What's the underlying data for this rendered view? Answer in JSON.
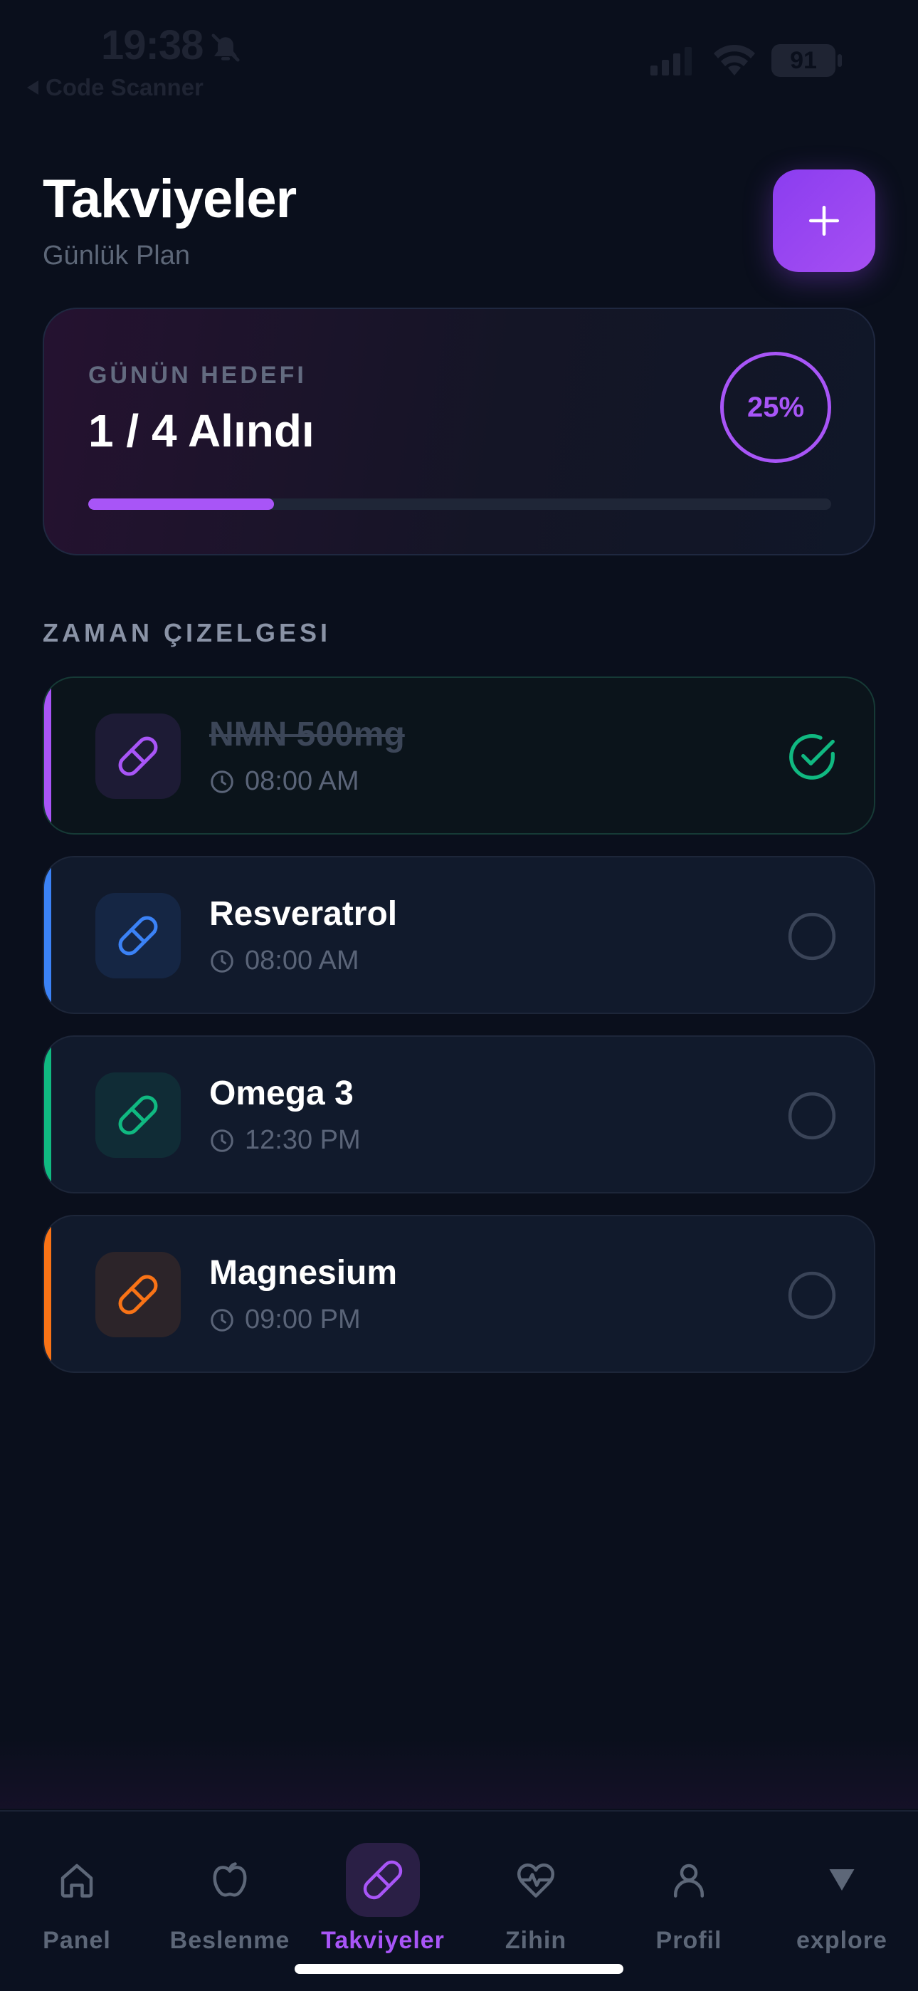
{
  "status_bar": {
    "time": "19:38",
    "back_label": "Code Scanner",
    "battery": "91"
  },
  "header": {
    "title": "Takviyeler",
    "subtitle": "Günlük Plan"
  },
  "goal": {
    "label": "GÜNÜN HEDEFI",
    "value": "1 / 4 Alındı",
    "percent_label": "25%",
    "progress": 0.25
  },
  "schedule": {
    "title": "ZAMAN ÇIZELGESI",
    "items": [
      {
        "name": "NMN 500mg",
        "time": "08:00 AM",
        "done": true,
        "color": "#a855f7"
      },
      {
        "name": "Resveratrol",
        "time": "08:00 AM",
        "done": false,
        "color": "#3b82f6"
      },
      {
        "name": "Omega 3",
        "time": "12:30 PM",
        "done": false,
        "color": "#10b981"
      },
      {
        "name": "Magnesium",
        "time": "09:00 PM",
        "done": false,
        "color": "#f97316"
      }
    ]
  },
  "tabs": [
    {
      "label": "Panel",
      "icon": "home-icon",
      "active": false
    },
    {
      "label": "Beslenme",
      "icon": "apple-icon",
      "active": false
    },
    {
      "label": "Takviyeler",
      "icon": "pill-icon",
      "active": true
    },
    {
      "label": "Zihin",
      "icon": "heart-pulse-icon",
      "active": false
    },
    {
      "label": "Profil",
      "icon": "user-icon",
      "active": false
    },
    {
      "label": "explore",
      "icon": "triangle-down-icon",
      "active": false
    }
  ],
  "colors": {
    "background": "#0a0f1c",
    "accent": "#a855f7",
    "done_green": "#10b981"
  }
}
